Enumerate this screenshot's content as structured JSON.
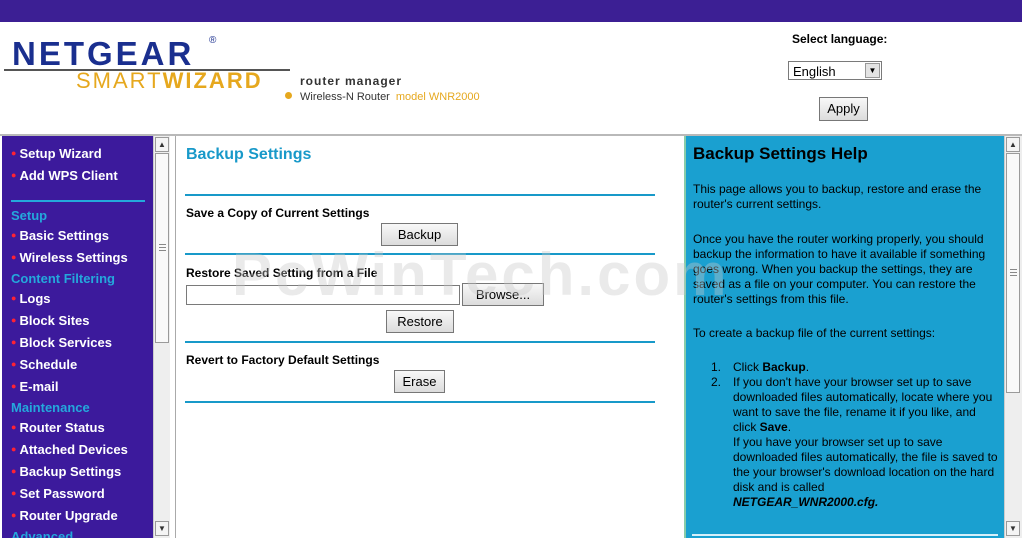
{
  "header": {
    "brand": "NETGEAR",
    "registered": "®",
    "smart": "SMART",
    "wizard": "WIZARD",
    "router_manager": "router manager",
    "product": "Wireless-N Router",
    "model": "model WNR2000",
    "select_language_label": "Select language:",
    "language_value": "English",
    "apply_label": "Apply"
  },
  "sidebar": {
    "top_items": [
      {
        "label": "Setup Wizard"
      },
      {
        "label": "Add WPS Client"
      }
    ],
    "sections": [
      {
        "title": "Setup",
        "items": [
          "Basic Settings",
          "Wireless Settings"
        ]
      },
      {
        "title": "Content Filtering",
        "items": [
          "Logs",
          "Block Sites",
          "Block Services",
          "Schedule",
          "E-mail"
        ]
      },
      {
        "title": "Maintenance",
        "items": [
          "Router Status",
          "Attached Devices",
          "Backup Settings",
          "Set Password",
          "Router Upgrade"
        ]
      },
      {
        "title": "Advanced",
        "items": []
      }
    ]
  },
  "main": {
    "title": "Backup Settings",
    "save_copy_label": "Save a Copy of Current Settings",
    "backup_button": "Backup",
    "restore_label": "Restore Saved Setting from a File",
    "browse_button": "Browse...",
    "file_value": "",
    "restore_button": "Restore",
    "revert_label": "Revert to Factory Default Settings",
    "erase_button": "Erase"
  },
  "watermark": "PcWinTech.com",
  "help": {
    "title": "Backup Settings Help",
    "p1": "This page allows you to backup, restore and erase the router's current settings.",
    "p2": "Once you have the router working properly, you should backup the information to have it available if something goes wrong. When you backup the settings, they are saved as a file on your computer. You can restore the router's settings from this file.",
    "p3": "To create a backup file of the current settings:",
    "step1_num": "1.",
    "step1_pre": "Click ",
    "step1_bold": "Backup",
    "step1_post": ".",
    "step2_num": "2.",
    "step2_text": "If you don't have your browser set up to save downloaded files automatically, locate where you want to save the file, rename it if you like, and click ",
    "step2_bold": "Save",
    "step2_post": ".",
    "step2b": "If you have your browser set up to save downloaded files automatically, the file is saved to the your browser's download location on the hard disk and is called",
    "filename": "NETGEAR_WNR2000.cfg."
  }
}
